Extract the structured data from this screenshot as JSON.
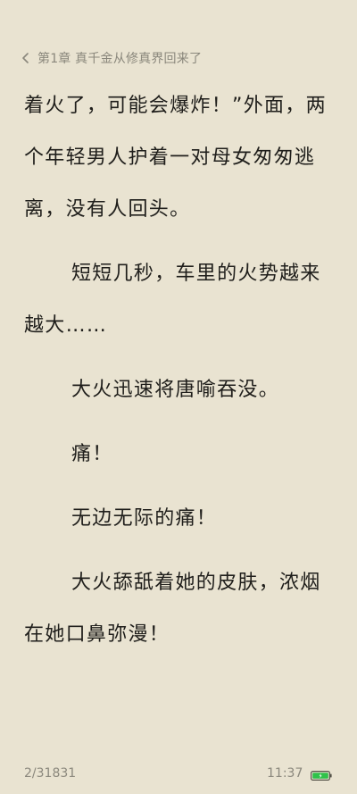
{
  "header": {
    "back_icon": "chevron-left-icon",
    "chapter_title": "第1章 真千金从修真界回来了"
  },
  "content": {
    "paragraphs": [
      "着火了，可能会爆炸！”外面，两个年轻男人护着一对母女匆匆逃离，没有人回头。",
      "短短几秒，车里的火势越来越大……",
      "大火迅速将唐喻吞没。",
      "痛！",
      "无边无际的痛！",
      "大火舔舐着她的皮肤，浓烟在她口鼻弥漫！"
    ]
  },
  "footer": {
    "page_counter": "2/31831",
    "clock": "11:37",
    "battery_icon": "battery-icon",
    "battery_color": "#2fc24a"
  },
  "theme": {
    "background": "#e9e3d1",
    "text_color": "#1f1e1b",
    "muted_color": "#8a877c"
  }
}
